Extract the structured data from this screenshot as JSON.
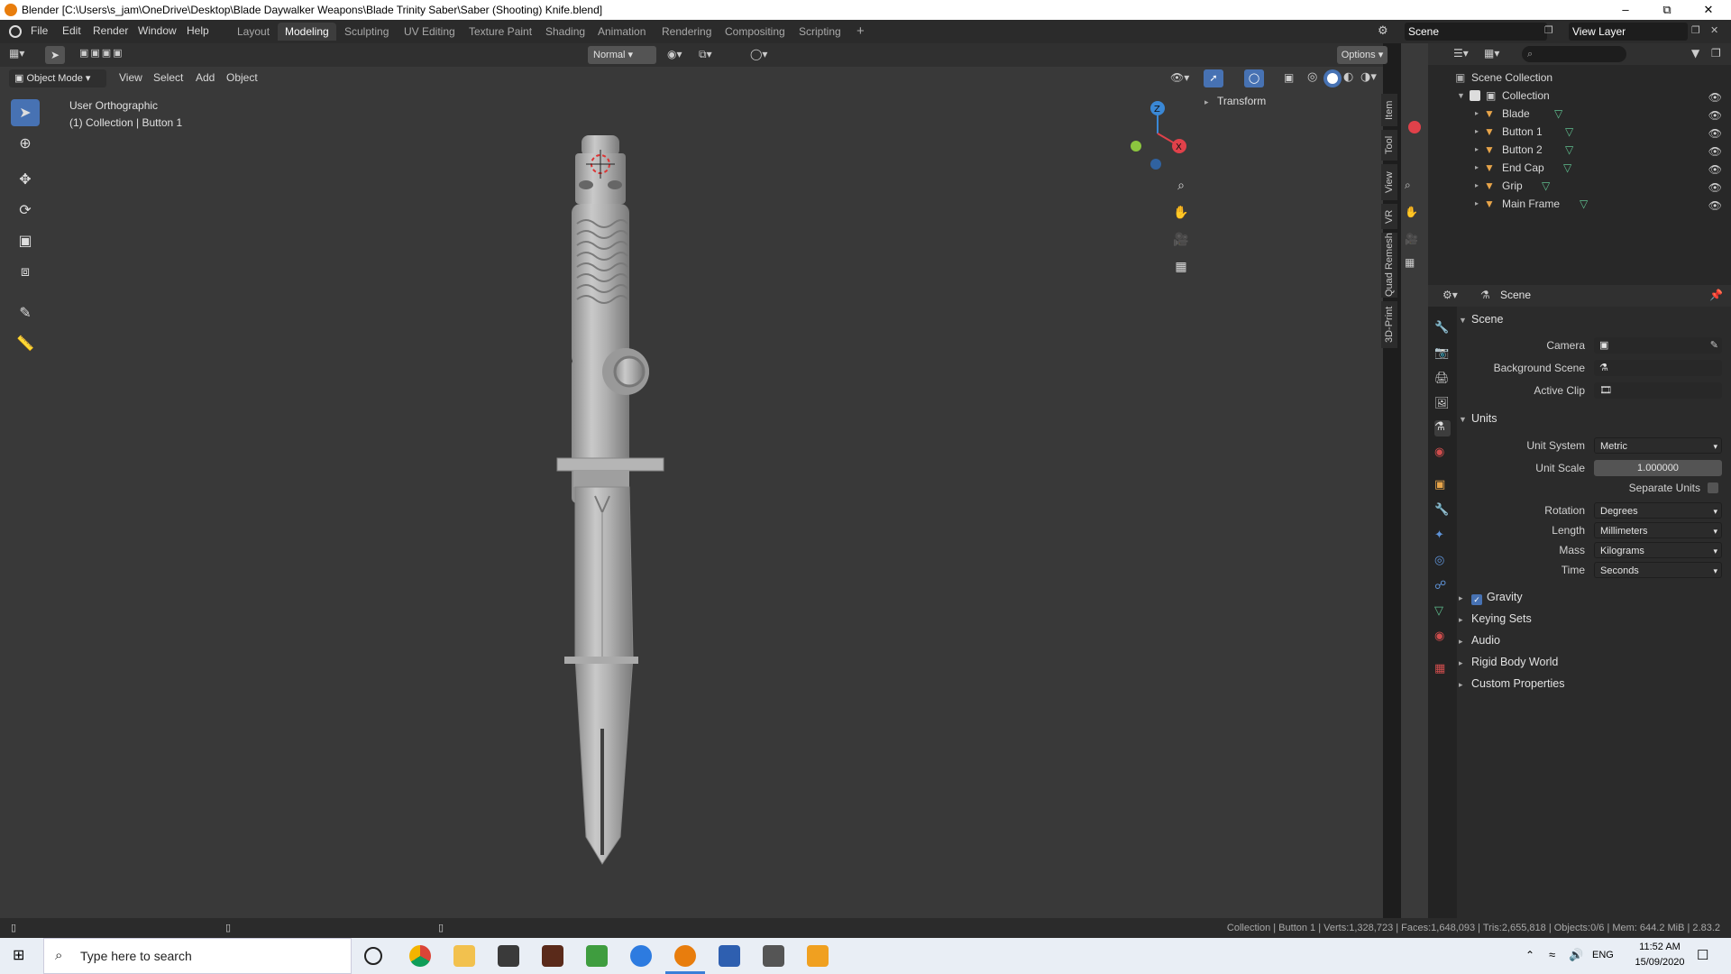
{
  "window": {
    "title": "Blender [C:\\Users\\s_jam\\OneDrive\\Desktop\\Blade Daywalker Weapons\\Blade Trinity Saber\\Saber (Shooting) Knife.blend]"
  },
  "menu": [
    "File",
    "Edit",
    "Render",
    "Window",
    "Help"
  ],
  "workspaces": [
    "Layout",
    "Modeling",
    "Sculpting",
    "UV Editing",
    "Texture Paint",
    "Shading",
    "Animation",
    "Rendering",
    "Compositing",
    "Scripting"
  ],
  "active_workspace": "Modeling",
  "topbar": {
    "scene": "Scene",
    "view_layer": "View Layer"
  },
  "viewport": {
    "orientation": "Normal",
    "options": "Options",
    "mode": "Object Mode",
    "menus": [
      "View",
      "Select",
      "Add",
      "Object"
    ],
    "view_name": "User Orthographic",
    "collection_info": "(1) Collection | Button 1",
    "transform_panel": "Transform",
    "side_tabs": [
      "Item",
      "Tool",
      "View",
      "VR",
      "Quad Remesh",
      "3D-Print"
    ],
    "gizmo": {
      "z": "Z",
      "x": "X"
    }
  },
  "outliner": {
    "root": "Scene Collection",
    "collection": "Collection",
    "objects": [
      "Blade",
      "Button 1",
      "Button 2",
      "End Cap",
      "Grip",
      "Main Frame"
    ]
  },
  "properties": {
    "header": "Scene",
    "scene_panel": "Scene",
    "camera_label": "Camera",
    "bg_scene_label": "Background Scene",
    "active_clip_label": "Active Clip",
    "units_panel": "Units",
    "unit_system_label": "Unit System",
    "unit_system": "Metric",
    "unit_scale_label": "Unit Scale",
    "unit_scale": "1.000000",
    "separate_units_label": "Separate Units",
    "rotation_label": "Rotation",
    "rotation": "Degrees",
    "length_label": "Length",
    "length": "Millimeters",
    "mass_label": "Mass",
    "mass": "Kilograms",
    "time_label": "Time",
    "time": "Seconds",
    "collapsed_panels": [
      "Gravity",
      "Keying Sets",
      "Audio",
      "Rigid Body World",
      "Custom Properties"
    ]
  },
  "statusbar": "Collection | Button 1 | Verts:1,328,723 | Faces:1,648,093 | Tris:2,655,818 | Objects:0/6 | Mem: 644.2 MiB | 2.83.2",
  "taskbar": {
    "search_placeholder": "Type here to search",
    "lang": "ENG",
    "time": "11:52 AM",
    "date": "15/09/2020"
  },
  "colors": {
    "accent": "#4772b3",
    "mesh_icon": "#5fbf8f",
    "object_icon": "#e8a54a",
    "gizmo_x": "#e0414a",
    "gizmo_y": "#8cc63f",
    "gizmo_z": "#3a88d6"
  }
}
